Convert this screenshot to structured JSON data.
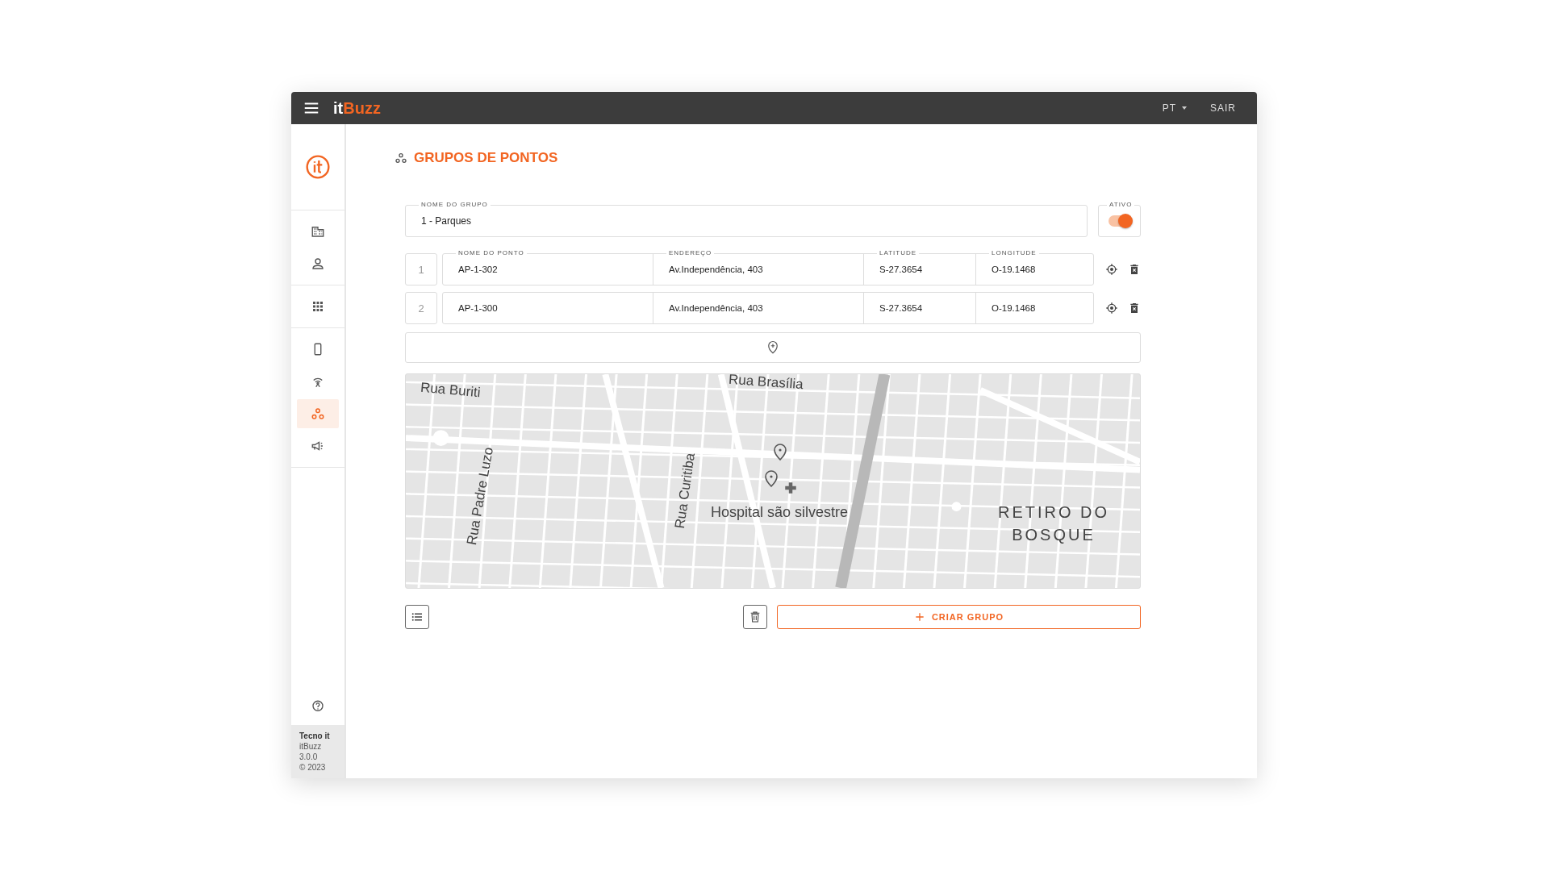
{
  "topbar": {
    "logo_prefix": "it",
    "logo_suffix": "Buzz",
    "language": "PT",
    "logout": "SAIR"
  },
  "sidebar": {
    "items": [
      {
        "selected": false
      },
      {
        "selected": false
      },
      {
        "selected": false
      },
      {
        "selected": false
      },
      {
        "selected": false
      },
      {
        "selected": true
      },
      {
        "selected": false
      }
    ],
    "footer": {
      "company": "Tecno it",
      "product": "itBuzz",
      "version": "3.0.0",
      "copyright": "© 2023"
    }
  },
  "page": {
    "title": "GRUPOS DE PONTOS"
  },
  "group": {
    "name_label": "NOME DO GRUPO",
    "name": "1 - Parques",
    "active_label": "ATIVO",
    "active": true
  },
  "points": {
    "columns": [
      "NOME DO PONTO",
      "ENDEREÇO",
      "LATITUDE",
      "LONGITUDE"
    ],
    "rows": [
      {
        "number": "1",
        "name": "AP-1-302",
        "address": "Av.Independência, 403",
        "latitude": "S-27.3654",
        "longitude": "O-19.1468"
      },
      {
        "number": "2",
        "name": "AP-1-300",
        "address": "Av.Independência, 403",
        "latitude": "S-27.3654",
        "longitude": "O-19.1468"
      }
    ]
  },
  "map": {
    "labels": [
      "Rua Brasília",
      "Rua Buriti",
      "Rua Padre Luzo",
      "Rua Curitiba",
      "Hospital são silvestre",
      "RETIRO DO BOSQUE"
    ]
  },
  "actions": {
    "create": "CRIAR GRUPO"
  }
}
